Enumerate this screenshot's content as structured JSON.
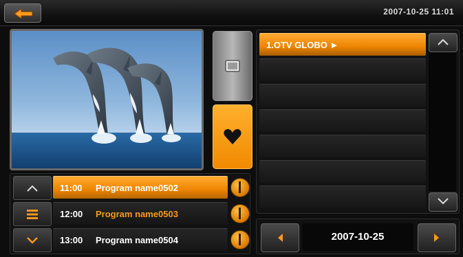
{
  "header": {
    "datetime": "2007-10-25 11:01",
    "back_icon": "back-arrow-icon"
  },
  "modes": [
    {
      "name": "tv-list",
      "icon": "tv-icon",
      "active": false
    },
    {
      "name": "favorites",
      "icon": "heart-icon",
      "active": true
    }
  ],
  "channels": {
    "items": [
      {
        "label": "1.OTV GLOBO ►",
        "selected": true
      },
      {
        "label": ""
      },
      {
        "label": ""
      },
      {
        "label": ""
      },
      {
        "label": ""
      },
      {
        "label": ""
      },
      {
        "label": ""
      }
    ]
  },
  "programs": [
    {
      "time": "11:00",
      "name": "Program name0502",
      "selected": true
    },
    {
      "time": "12:00",
      "name": "Program name0503",
      "highlighted": true
    },
    {
      "time": "13:00",
      "name": "Program name0504"
    }
  ],
  "date_nav": {
    "date": "2007-10-25"
  },
  "colors": {
    "accent": "#f08a00",
    "background": "#0d0d0d"
  }
}
